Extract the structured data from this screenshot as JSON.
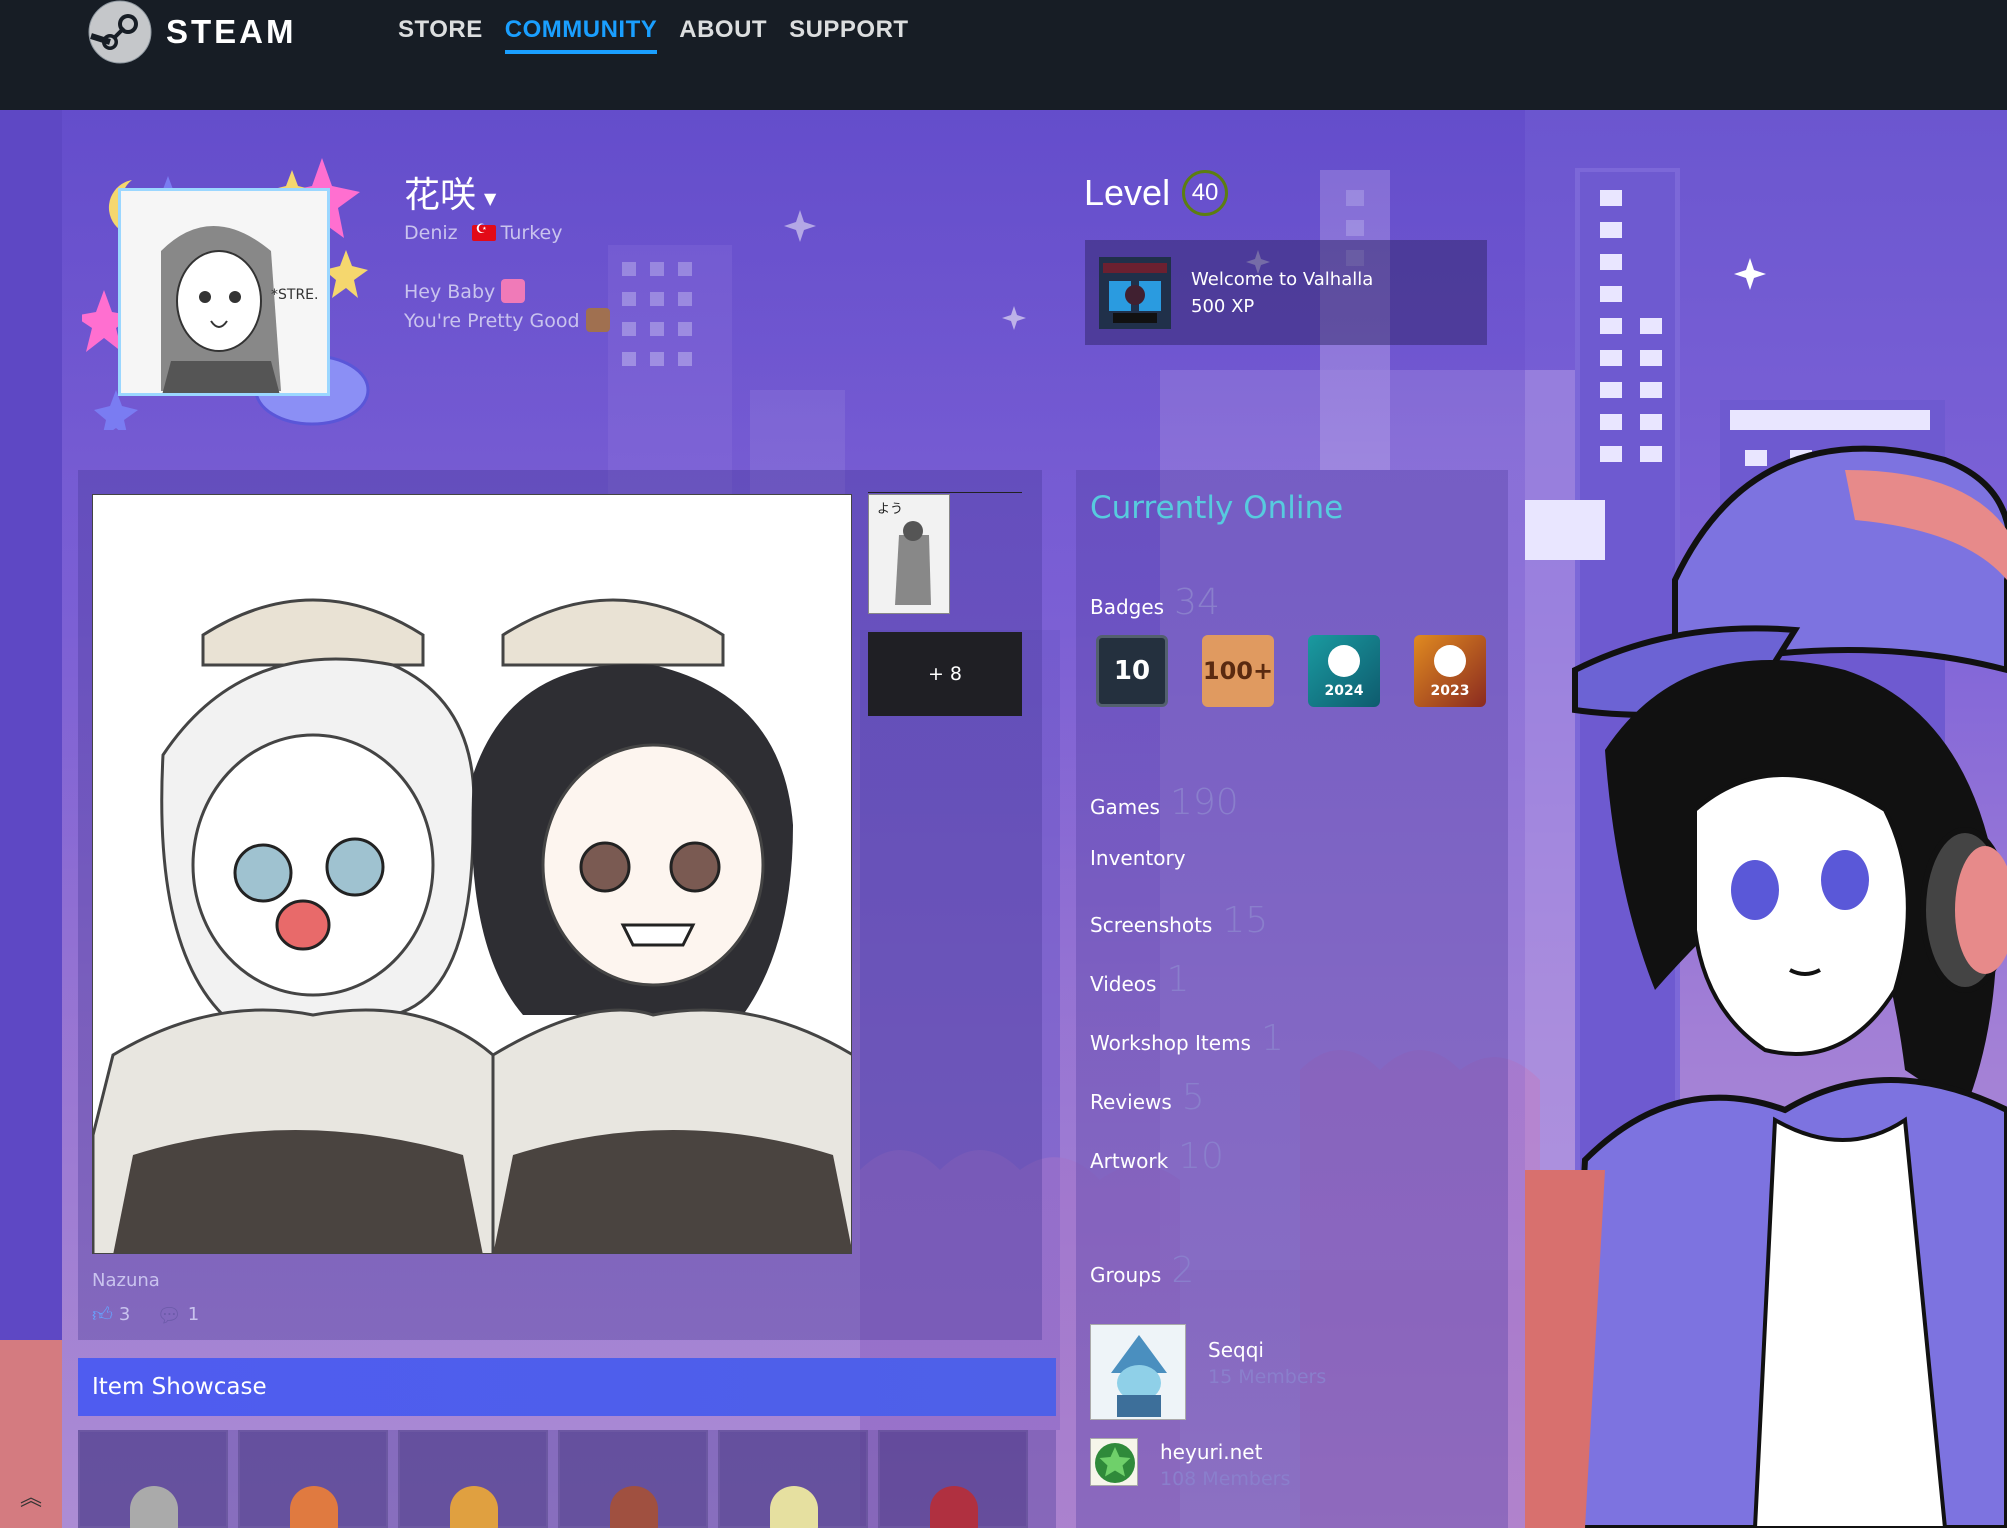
{
  "nav": {
    "logo_text": "STEAM",
    "items": [
      {
        "label": "STORE",
        "active": false
      },
      {
        "label": "COMMUNITY",
        "active": true
      },
      {
        "label": "ABOUT",
        "active": false
      },
      {
        "label": "SUPPORT",
        "active": false
      }
    ]
  },
  "profile": {
    "persona_name": "花咲",
    "real_name": "Deniz",
    "country": "Turkey",
    "summary_line1": "Hey Baby",
    "summary_line2": "You're Pretty Good",
    "level_label": "Level",
    "level": "40",
    "favorite_badge": {
      "name": "Welcome to Valhalla",
      "xp": "500 XP"
    }
  },
  "screenshot_showcase": {
    "more_label": "+ 8",
    "title": "Nazuna",
    "rating_count": "3",
    "comment_count": "1"
  },
  "item_showcase": {
    "title": "Item Showcase"
  },
  "sidebar": {
    "online_status": "Currently Online",
    "badges_label": "Badges",
    "badges_count": "34",
    "badge_icons": [
      {
        "name": "years-of-service-badge",
        "text": "10"
      },
      {
        "name": "games-owned-badge",
        "text": "100+"
      },
      {
        "name": "steam-replay-badge",
        "text": "2024"
      },
      {
        "name": "steam-replay-badge",
        "text": "2023"
      }
    ],
    "counts": [
      {
        "label": "Games",
        "value": "190"
      },
      {
        "label": "Inventory",
        "value": ""
      },
      {
        "label": "Screenshots",
        "value": "15"
      },
      {
        "label": "Videos",
        "value": "1"
      },
      {
        "label": "Workshop Items",
        "value": "1"
      },
      {
        "label": "Reviews",
        "value": "5"
      },
      {
        "label": "Artwork",
        "value": "10"
      }
    ],
    "groups_label": "Groups",
    "groups_count": "2",
    "groups": [
      {
        "name": "Seqqi",
        "members": "15 Members"
      },
      {
        "name": "heyuri.net",
        "members": "108 Members"
      }
    ]
  },
  "colors": {
    "nav_active": "#1a9fff",
    "online": "#57cbde",
    "item_header": "#4f5cf0",
    "level_ring": "#5c7e10"
  }
}
